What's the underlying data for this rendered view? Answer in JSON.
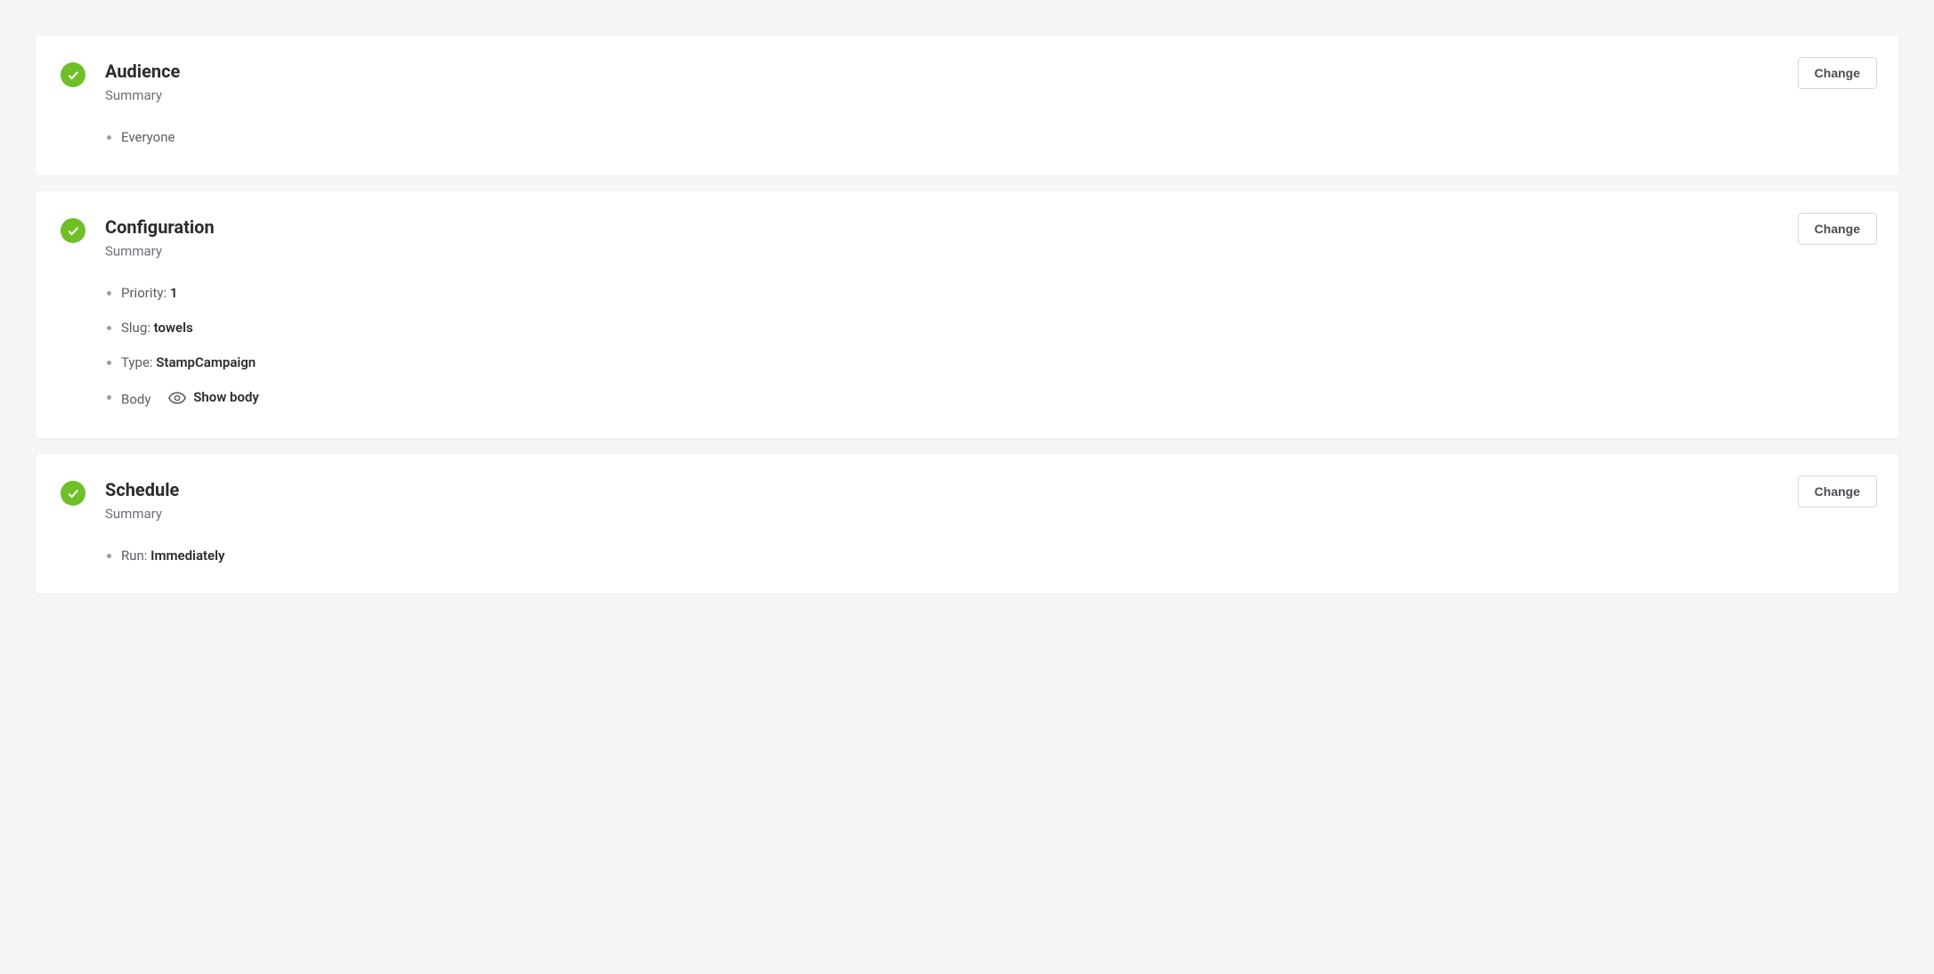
{
  "common": {
    "change_button": "Change",
    "summary_label": "Summary"
  },
  "audience": {
    "title": "Audience",
    "items": {
      "everyone": "Everyone"
    }
  },
  "configuration": {
    "title": "Configuration",
    "priority_label": "Priority: ",
    "priority_value": "1",
    "slug_label": "Slug: ",
    "slug_value": "towels",
    "type_label": "Type: ",
    "type_value": "StampCampaign",
    "body_label": "Body",
    "show_body_label": "Show body"
  },
  "schedule": {
    "title": "Schedule",
    "run_label": "Run: ",
    "run_value": "Immediately"
  }
}
